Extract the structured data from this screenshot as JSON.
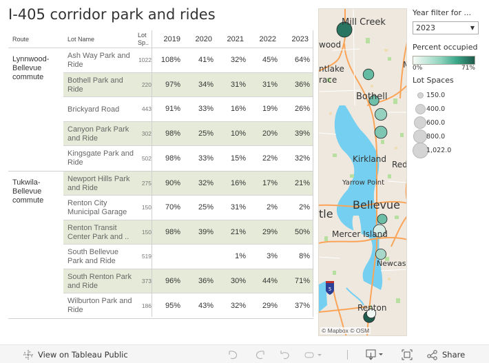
{
  "title": "I-405 corridor park and rides",
  "table": {
    "headers": {
      "route": "Route",
      "lot_name": "Lot Name",
      "lot_spaces": "Lot Sp..",
      "years": [
        "2019",
        "2020",
        "2021",
        "2022",
        "2023"
      ]
    },
    "groups": [
      {
        "route": "Lynnwood-Bellevue commute",
        "rows": [
          {
            "name": "Ash Way Park and Ride",
            "spaces": "1022",
            "values": [
              "108%",
              "41%",
              "32%",
              "45%",
              "64%"
            ],
            "shaded": false
          },
          {
            "name": "Bothell Park and Ride",
            "spaces": "220",
            "values": [
              "97%",
              "34%",
              "31%",
              "31%",
              "36%"
            ],
            "shaded": true
          },
          {
            "name": "Brickyard Road",
            "spaces": "443",
            "values": [
              "91%",
              "33%",
              "16%",
              "19%",
              "26%"
            ],
            "shaded": false
          },
          {
            "name": "Canyon Park Park and Ride",
            "spaces": "302",
            "values": [
              "98%",
              "25%",
              "10%",
              "20%",
              "39%"
            ],
            "shaded": true
          },
          {
            "name": "Kingsgate Park and Ride",
            "spaces": "502",
            "values": [
              "98%",
              "33%",
              "15%",
              "22%",
              "32%"
            ],
            "shaded": false
          }
        ]
      },
      {
        "route": "Tukwila-Bellevue commute",
        "rows": [
          {
            "name": "Newport Hills Park and Ride",
            "spaces": "275",
            "values": [
              "90%",
              "32%",
              "16%",
              "17%",
              "21%"
            ],
            "shaded": true
          },
          {
            "name": "Renton City Municipal Garage",
            "spaces": "150",
            "values": [
              "70%",
              "25%",
              "31%",
              "2%",
              "2%"
            ],
            "shaded": false
          },
          {
            "name": "Renton Transit Center Park and ..",
            "spaces": "150",
            "values": [
              "98%",
              "39%",
              "21%",
              "29%",
              "50%"
            ],
            "shaded": true
          },
          {
            "name": "South Bellevue Park and Ride",
            "spaces": "519",
            "values": [
              "",
              "",
              "1%",
              "3%",
              "8%"
            ],
            "shaded": false
          },
          {
            "name": "South Renton Park and Ride",
            "spaces": "373",
            "values": [
              "96%",
              "36%",
              "30%",
              "44%",
              "71%"
            ],
            "shaded": true
          },
          {
            "name": "Wilburton Park and Ride",
            "spaces": "186",
            "values": [
              "95%",
              "43%",
              "32%",
              "29%",
              "37%"
            ],
            "shaded": false
          }
        ]
      }
    ]
  },
  "map": {
    "places": [
      "Mill Creek",
      "wood",
      "ntlake",
      "race",
      "Bothell",
      "Kirkland",
      "Red",
      "Yarrow Point",
      "Bellevue",
      "tle",
      "Mercer Island",
      "Newcast",
      "Renton",
      "M"
    ],
    "attribution": "© Mapbox  © OSM",
    "shield": "5",
    "markers": [
      {
        "lot": "Ash Way Park and Ride",
        "pct": 64,
        "spaces": 1022
      },
      {
        "lot": "Canyon Park Park and Ride",
        "pct": 39,
        "spaces": 302
      },
      {
        "lot": "Bothell Park and Ride",
        "pct": 36,
        "spaces": 220
      },
      {
        "lot": "Brickyard Road",
        "pct": 26,
        "spaces": 443
      },
      {
        "lot": "Kingsgate Park and Ride",
        "pct": 32,
        "spaces": 502
      },
      {
        "lot": "Wilburton Park and Ride",
        "pct": 37,
        "spaces": 186
      },
      {
        "lot": "South Bellevue Park and Ride",
        "pct": 8,
        "spaces": 519
      },
      {
        "lot": "Newport Hills Park and Ride",
        "pct": 21,
        "spaces": 275
      },
      {
        "lot": "Renton City Municipal Garage",
        "pct": 2,
        "spaces": 150
      },
      {
        "lot": "South Renton Park and Ride",
        "pct": 71,
        "spaces": 373
      }
    ]
  },
  "filters": {
    "year_label": "Year filter for ...",
    "year_value": "2023",
    "color_legend_title": "Percent occupied",
    "color_min": "0%",
    "color_max": "71%",
    "color_low": "#f7fbf8",
    "color_high": "#1f5b4c",
    "size_legend_title": "Lot Spaces",
    "size_items": [
      "150.0",
      "400.0",
      "600.0",
      "800.0",
      "1,022.0"
    ]
  },
  "toolbar": {
    "view_on": "View on Tableau Public",
    "share": "Share"
  }
}
